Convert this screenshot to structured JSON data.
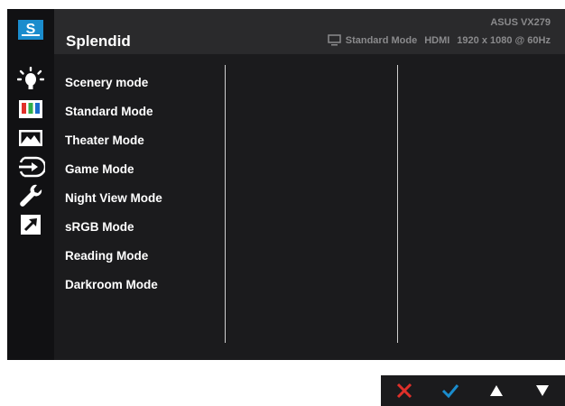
{
  "osd": {
    "title": "Splendid",
    "model": "ASUS VX279",
    "status": {
      "mode": "Standard Mode",
      "input": "HDMI",
      "resolution": "1920 x 1080 @ 60Hz"
    }
  },
  "sidebar": {
    "items": [
      {
        "icon": "splendid-icon",
        "label": "S"
      },
      {
        "icon": "brightness-icon"
      },
      {
        "icon": "color-icon"
      },
      {
        "icon": "image-icon"
      },
      {
        "icon": "input-select-icon"
      },
      {
        "icon": "system-setup-icon"
      },
      {
        "icon": "shortcut-icon"
      }
    ]
  },
  "menu": {
    "items": [
      "Scenery mode",
      "Standard Mode",
      "Theater Mode",
      "Game Mode",
      "Night View Mode",
      "sRGB Mode",
      "Reading Mode",
      "Darkroom Mode"
    ]
  },
  "keys": [
    {
      "icon": "close-icon",
      "color": "#e0302a"
    },
    {
      "icon": "check-icon",
      "color": "#1a8ccd"
    },
    {
      "icon": "up-arrow-icon",
      "color": "#ffffff"
    },
    {
      "icon": "down-arrow-icon",
      "color": "#ffffff"
    }
  ],
  "colors": {
    "accent": "#1a8ccd",
    "osd_background": "#1b1b1d",
    "header_background": "#2a2a2c",
    "muted_text": "#8a8a8c"
  }
}
